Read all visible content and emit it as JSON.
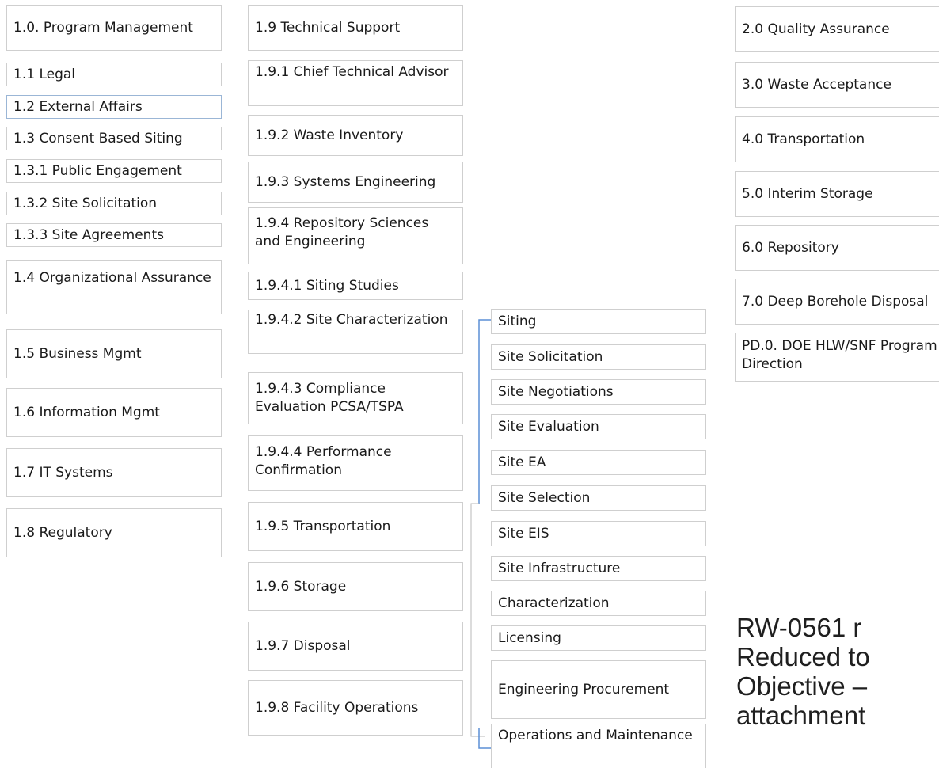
{
  "column1": {
    "items": [
      "1.0. Program Management",
      "1.1 Legal",
      "1.2 External Affairs",
      "1.3 Consent Based Siting",
      "1.3.1 Public Engagement",
      "1.3.2 Site Solicitation",
      "1.3.3 Site Agreements",
      "1.4 Organizational Assurance",
      "1.5 Business Mgmt",
      "1.6 Information Mgmt",
      "1.7 IT Systems",
      "1.8 Regulatory"
    ]
  },
  "column2": {
    "items": [
      "1.9 Technical Support",
      "1.9.1 Chief Technical Advisor",
      "1.9.2 Waste Inventory",
      "1.9.3 Systems Engineering",
      "1.9.4 Repository Sciences and Engineering",
      "1.9.4.1 Siting Studies",
      "1.9.4.2 Site Characterization",
      "1.9.4.3 Compliance Evaluation PCSA/TSPA",
      "1.9.4.4 Performance Confirmation",
      "1.9.5 Transportation",
      "1.9.6 Storage",
      "1.9.7 Disposal",
      "1.9.8 Facility Operations"
    ]
  },
  "column3": {
    "items": [
      "Siting",
      "Site Solicitation",
      "Site Negotiations",
      "Site Evaluation",
      "Site EA",
      "Site Selection",
      "Site EIS",
      "Site Infrastructure",
      "Characterization",
      "Licensing",
      "Engineering Procurement",
      "Operations and Maintenance"
    ]
  },
  "column4": {
    "items": [
      "2.0 Quality Assurance",
      "3.0 Waste Acceptance",
      "4.0 Transportation",
      "5.0 Interim Storage",
      "6.0 Repository",
      "7.0 Deep Borehole Disposal",
      "PD.0. DOE HLW/SNF Program Direction"
    ]
  },
  "note": {
    "lines": [
      "RW-0561 r",
      "Reduced to",
      "Objective –",
      "attachment"
    ]
  },
  "colors": {
    "box_border": "#cfcfcf",
    "connector": "#5b8fd6"
  }
}
